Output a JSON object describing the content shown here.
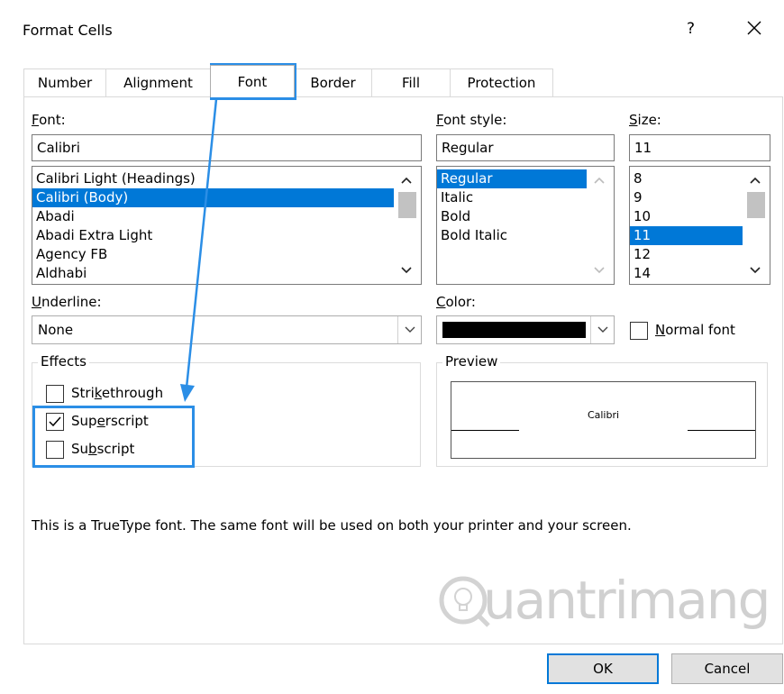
{
  "window": {
    "title": "Format Cells",
    "help": "?"
  },
  "tabs": [
    {
      "label": "Number"
    },
    {
      "label": "Alignment"
    },
    {
      "label": "Font"
    },
    {
      "label": "Border"
    },
    {
      "label": "Fill"
    },
    {
      "label": "Protection"
    }
  ],
  "font": {
    "label_key": "F",
    "label_rest": "ont:",
    "value": "Calibri",
    "list": [
      "Calibri Light (Headings)",
      "Calibri (Body)",
      "Abadi",
      "Abadi Extra Light",
      "Agency FB",
      "Aldhabi"
    ],
    "selected_index": 1
  },
  "style": {
    "label_pre": "F",
    "label_key": "o",
    "label_rest": "nt style:",
    "value": "Regular",
    "list": [
      "Regular",
      "Italic",
      "Bold",
      "Bold Italic"
    ],
    "selected_index": 0
  },
  "size": {
    "label_key": "S",
    "label_rest": "ize:",
    "value": "11",
    "list": [
      "8",
      "9",
      "10",
      "11",
      "12",
      "14"
    ],
    "selected_index": 3
  },
  "underline": {
    "label_key": "U",
    "label_rest": "nderline:",
    "value": "None"
  },
  "color": {
    "label_key": "C",
    "label_rest": "olor:",
    "swatch": "#000000"
  },
  "normal_font": {
    "label_key": "N",
    "label_rest": "ormal font",
    "checked": false
  },
  "effects": {
    "title": "Effects",
    "strikethrough": {
      "pre": "Stri",
      "key": "k",
      "rest": "ethrough",
      "checked": false
    },
    "superscript": {
      "pre": "Sup",
      "key": "e",
      "rest": "rscript",
      "checked": true
    },
    "subscript": {
      "pre": "Su",
      "key": "b",
      "rest": "script",
      "checked": false
    }
  },
  "preview": {
    "title": "Preview",
    "sample": "Calibri"
  },
  "info": "This is a TrueType font.  The same font will be used on both your printer and your screen.",
  "buttons": {
    "ok": "OK",
    "cancel": "Cancel"
  },
  "watermark": "uantrimang",
  "colors": {
    "accent": "#0078d7",
    "highlight": "#2b8ee6"
  }
}
